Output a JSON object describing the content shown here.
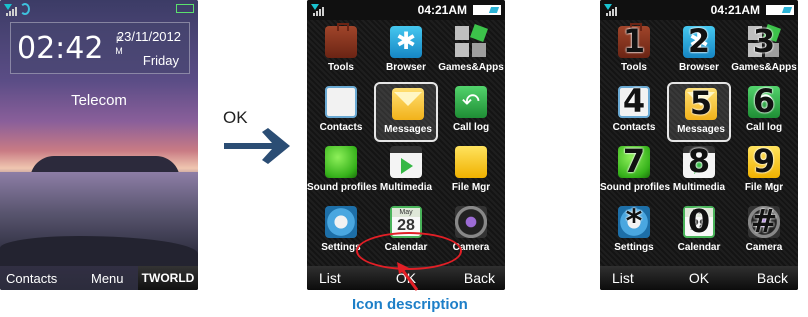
{
  "home": {
    "time": "02:42",
    "ampm_top": "P",
    "ampm_bottom": "M",
    "date": "23/11/2012",
    "day": "Friday",
    "operator": "Telecom",
    "softkeys": {
      "left": "Contacts",
      "center": "Menu",
      "right": "TWORLD"
    }
  },
  "transition_label": "OK",
  "menu_status_time": "04:21AM",
  "menu_items": [
    {
      "label": "Tools",
      "icon": "tools-icon",
      "key": "1"
    },
    {
      "label": "Browser",
      "icon": "browser-icon",
      "key": "2"
    },
    {
      "label": "Games&Apps",
      "icon": "games-apps-icon",
      "key": "3"
    },
    {
      "label": "Contacts",
      "icon": "contacts-icon",
      "key": "4"
    },
    {
      "label": "Messages",
      "icon": "messages-icon",
      "key": "5"
    },
    {
      "label": "Call log",
      "icon": "call-log-icon",
      "key": "6"
    },
    {
      "label": "Sound profiles",
      "icon": "sound-profiles-icon",
      "key": "7"
    },
    {
      "label": "Multimedia",
      "icon": "multimedia-icon",
      "key": "8"
    },
    {
      "label": "File Mgr",
      "icon": "file-manager-icon",
      "key": "9"
    },
    {
      "label": "Settings",
      "icon": "settings-icon",
      "key": "*"
    },
    {
      "label": "Calendar",
      "icon": "calendar-icon",
      "key": "0"
    },
    {
      "label": "Camera",
      "icon": "camera-icon",
      "key": "#"
    }
  ],
  "calendar_icon": {
    "month": "May",
    "day": "28"
  },
  "menu_softkeys": {
    "left": "List",
    "center": "OK",
    "right": "Back"
  },
  "callout": {
    "label": "Icon description",
    "color": "#1d7fc8",
    "ring_color": "#e11f26"
  },
  "selected_item": "Messages"
}
